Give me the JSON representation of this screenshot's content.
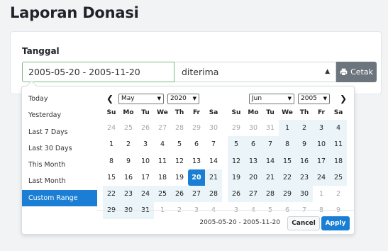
{
  "page": {
    "title": "Laporan Donasi"
  },
  "filter": {
    "label": "Tanggal",
    "date_value": "2005-05-20 - 2005-11-20",
    "status_value": "diterima",
    "print_label": "Cetak"
  },
  "picker": {
    "ranges": [
      "Today",
      "Yesterday",
      "Last 7 Days",
      "Last 30 Days",
      "This Month",
      "Last Month",
      "Custom Range"
    ],
    "active_range": 6,
    "weekdays": [
      "Su",
      "Mo",
      "Tu",
      "We",
      "Th",
      "Fr",
      "Sa"
    ],
    "left": {
      "month": "May",
      "year": "2020",
      "days": [
        [
          "24",
          "25",
          "26",
          "27",
          "28",
          "29",
          "30"
        ],
        [
          "1",
          "2",
          "3",
          "4",
          "5",
          "6",
          "7"
        ],
        [
          "8",
          "9",
          "10",
          "11",
          "12",
          "13",
          "14"
        ],
        [
          "15",
          "16",
          "17",
          "18",
          "19",
          "20",
          "21"
        ],
        [
          "22",
          "23",
          "24",
          "25",
          "26",
          "27",
          "28"
        ],
        [
          "29",
          "30",
          "31",
          "1",
          "2",
          "3",
          "4"
        ]
      ]
    },
    "right": {
      "month": "Jun",
      "year": "2005",
      "days": [
        [
          "29",
          "30",
          "31",
          "1",
          "2",
          "3",
          "4"
        ],
        [
          "5",
          "6",
          "7",
          "8",
          "9",
          "10",
          "11"
        ],
        [
          "12",
          "13",
          "14",
          "15",
          "16",
          "17",
          "18"
        ],
        [
          "19",
          "20",
          "21",
          "22",
          "23",
          "24",
          "25"
        ],
        [
          "26",
          "27",
          "28",
          "29",
          "30",
          "1",
          "2"
        ],
        [
          "3",
          "4",
          "5",
          "6",
          "7",
          "8",
          "9"
        ]
      ]
    },
    "selected_text": "2005-05-20 - 2005-11-20",
    "cancel_label": "Cancel",
    "apply_label": "Apply"
  },
  "colors": {
    "accent": "#1a7fd4",
    "range_bg": "#ebf4f8",
    "print_bg": "#6c757d"
  },
  "icons": {
    "print": "printer-icon",
    "prev": "chevron-left-icon",
    "next": "chevron-right-icon"
  }
}
